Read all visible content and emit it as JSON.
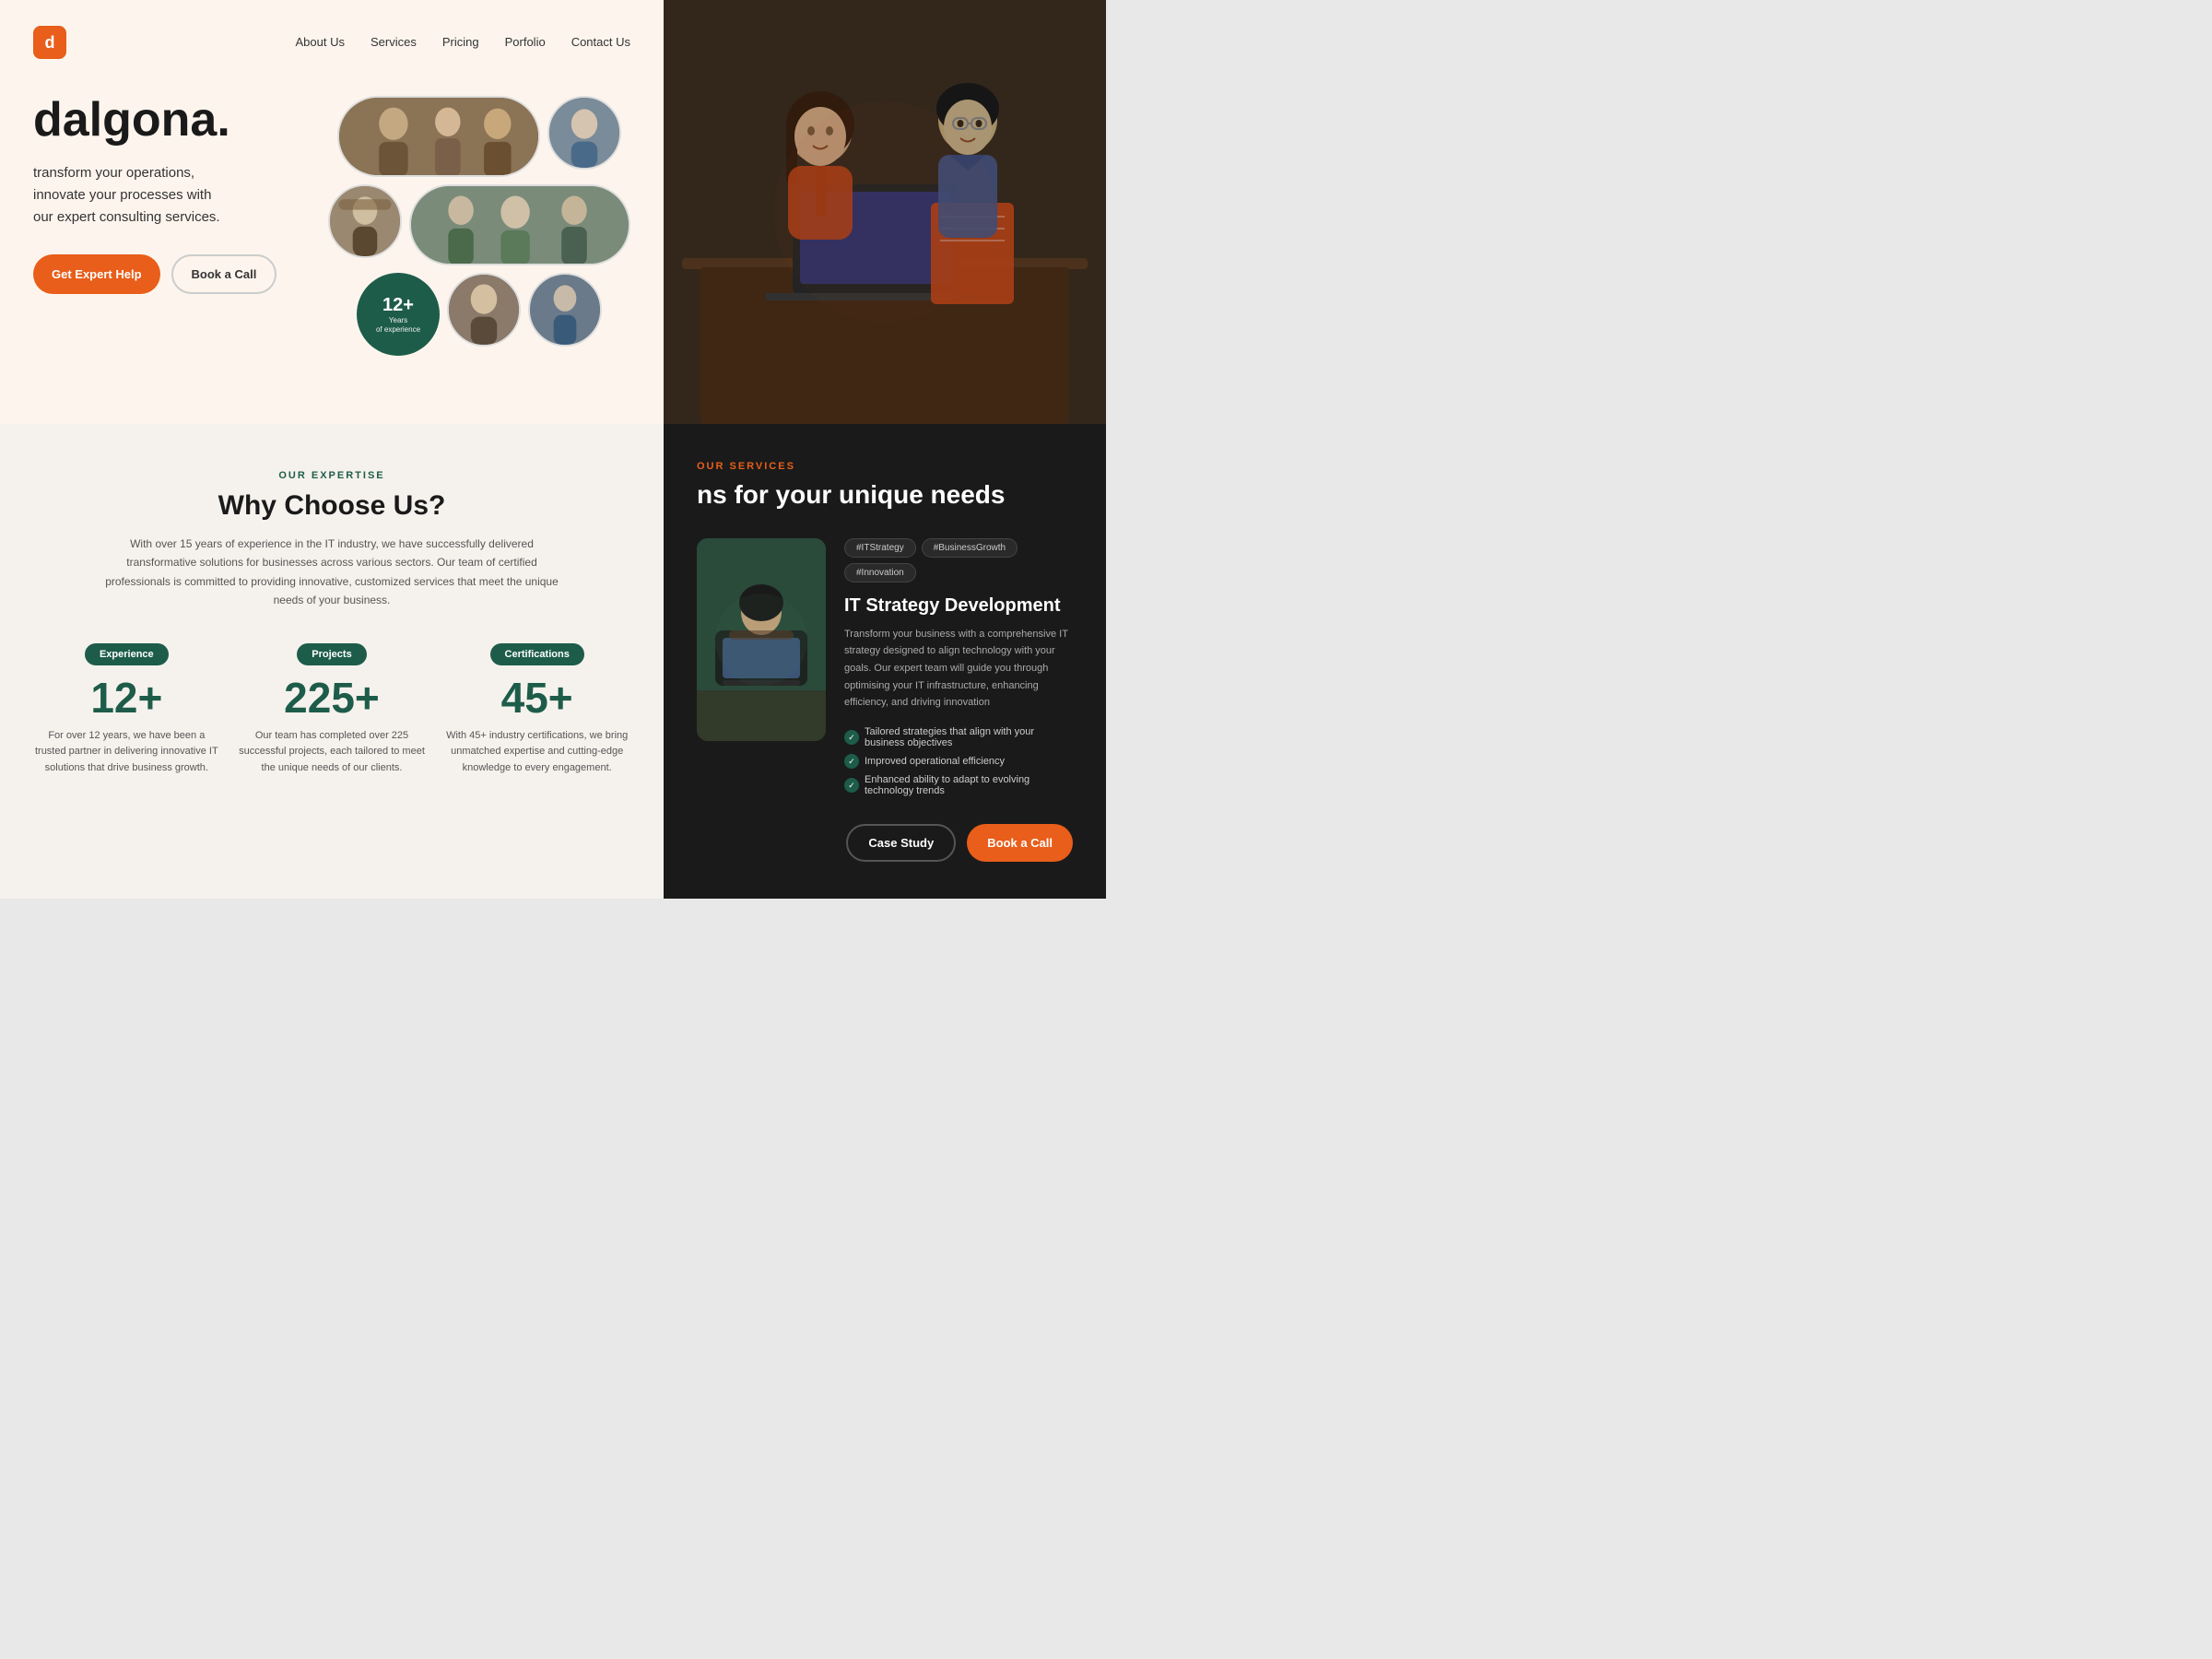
{
  "nav": {
    "logo_letter": "d",
    "links": [
      {
        "label": "About Us",
        "href": "#"
      },
      {
        "label": "Services",
        "href": "#"
      },
      {
        "label": "Pricing",
        "href": "#"
      },
      {
        "label": "Porfolio",
        "href": "#"
      },
      {
        "label": "Contact Us",
        "href": "#"
      }
    ]
  },
  "hero": {
    "brand": "dalgona.",
    "tagline": "transform your operations,\ninnovate your processes with\nour expert consulting services.",
    "cta_primary": "Get Expert Help",
    "cta_secondary": "Book a Call",
    "stat_number": "12+",
    "stat_label_line1": "Years",
    "stat_label_line2": "of experience"
  },
  "expertise": {
    "section_label": "OUR EXPERTISE",
    "title": "Why Choose Us?",
    "description": "With over 15 years of experience in the IT industry, we have successfully delivered transformative solutions for businesses across various sectors. Our team of certified professionals is committed to providing innovative, customized services that meet the unique needs of your business.",
    "stats": [
      {
        "badge": "Experience",
        "number": "12+",
        "description": "For over 12 years, we have been a trusted partner in delivering innovative IT solutions that drive business growth."
      },
      {
        "badge": "Projects",
        "number": "225+",
        "description": "Our team has completed over 225 successful projects, each tailored to meet the unique needs of our clients."
      },
      {
        "badge": "Certifications",
        "number": "45+",
        "description": "With 45+ industry certifications, we bring unmatched expertise and cutting-edge knowledge to every engagement."
      }
    ]
  },
  "services": {
    "section_label": "OUR SERVICES",
    "title": "ns for your unique needs",
    "card": {
      "tags": [
        "#ITStrategy",
        "#BusinessGrowth",
        "#Innovation"
      ],
      "name": "IT Strategy Development",
      "description": "Transform your business with a comprehensive IT strategy designed to align technology with your goals. Our expert team will guide you through optimising your IT infrastructure, enhancing efficiency, and driving innovation",
      "features": [
        "Tailored strategies that align with your business objectives",
        "Improved operational efficiency",
        "Enhanced ability to adapt to evolving technology trends"
      ],
      "btn_case_study": "Case Study",
      "btn_book_call": "Book a Call"
    }
  }
}
